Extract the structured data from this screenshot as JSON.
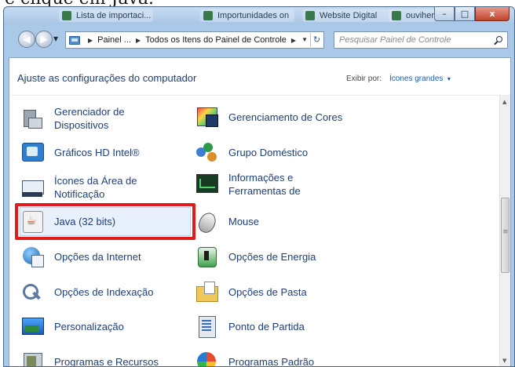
{
  "caption_text": "e clique em Java.",
  "window": {
    "taskbar_tabs": [
      "Lista de importaci...",
      "Importunidades on",
      "Website Digital",
      "ouvihers_"
    ],
    "controls": {
      "minimize": "–",
      "maximize": "□",
      "close": "x"
    }
  },
  "nav": {
    "back": "◀",
    "forward": "▶",
    "breadcrumb": [
      "Painel ...",
      "Todos os Itens do Painel de Controle"
    ],
    "search_placeholder": "Pesquisar Painel de Controle"
  },
  "header": {
    "title": "Ajuste as configurações do computador",
    "view_label": "Exibir por:",
    "view_value": "Ícones grandes"
  },
  "items": [
    {
      "label": "Gerenciador de Dispositivos",
      "icon": "device-manager-icon"
    },
    {
      "label": "Gerenciamento de Cores",
      "icon": "color-management-icon"
    },
    {
      "label": "Gráficos HD Intel®",
      "icon": "intel-graphics-icon"
    },
    {
      "label": "Grupo Doméstico",
      "icon": "homegroup-icon"
    },
    {
      "label": "Ícones da Área de Notificação",
      "icon": "notification-area-icon"
    },
    {
      "label": "Informações e Ferramentas de",
      "icon": "performance-info-icon"
    },
    {
      "label": "Java (32 bits)",
      "icon": "java-icon"
    },
    {
      "label": "Mouse",
      "icon": "mouse-icon"
    },
    {
      "label": "Opções da Internet",
      "icon": "internet-options-icon"
    },
    {
      "label": "Opções de Energia",
      "icon": "power-options-icon"
    },
    {
      "label": "Opções de Indexação",
      "icon": "indexing-options-icon"
    },
    {
      "label": "Opções de Pasta",
      "icon": "folder-options-icon"
    },
    {
      "label": "Personalização",
      "icon": "personalization-icon"
    },
    {
      "label": "Ponto de Partida",
      "icon": "getting-started-icon"
    },
    {
      "label": "Programas e Recursos",
      "icon": "programs-features-icon"
    },
    {
      "label": "Programas Padrão",
      "icon": "default-programs-icon"
    }
  ],
  "colors": {
    "link": "#1e3f78",
    "highlight_border": "#e11b1b",
    "window_frame": "#aac8e8"
  }
}
